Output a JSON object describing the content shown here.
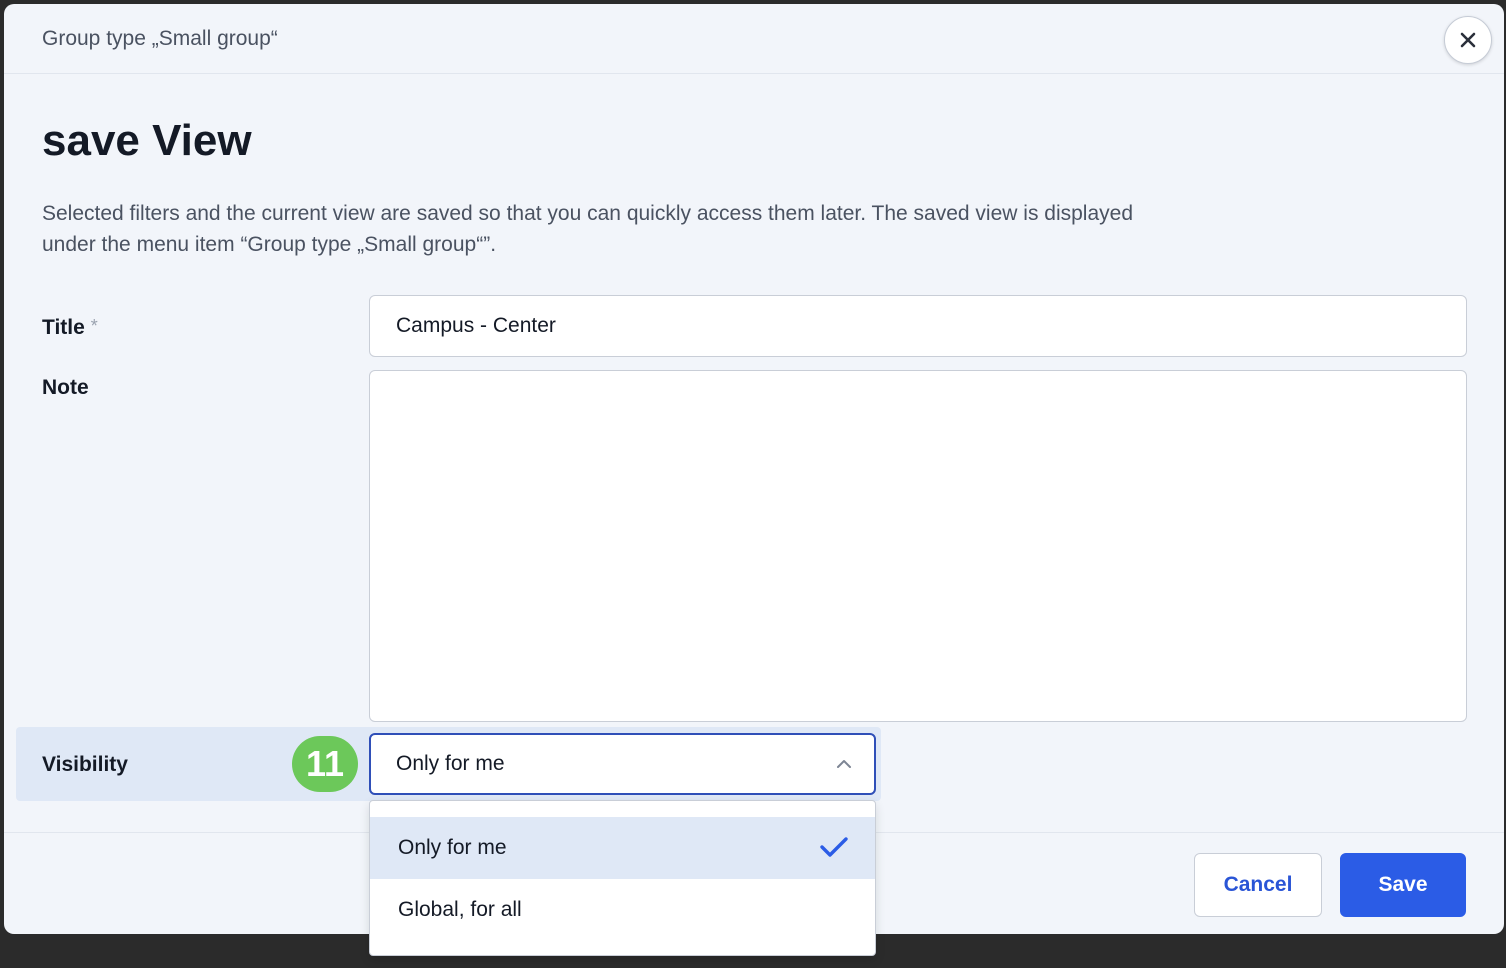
{
  "modal": {
    "header_title": "Group type „Small group“",
    "close_icon": "close-icon",
    "page_title": "save View",
    "description": "Selected filters and the current view are saved so that you can quickly access them later. The saved view is displayed under the menu item “Group type „Small group“”."
  },
  "form": {
    "title_label": "Title",
    "title_required": "*",
    "title_value": "Campus - Center",
    "note_label": "Note",
    "note_value": "",
    "visibility_label": "Visibility",
    "step_badge": "11",
    "visibility_selected": "Only for me",
    "visibility_options": [
      {
        "label": "Only for me",
        "selected": true
      },
      {
        "label": "Global, for all",
        "selected": false
      }
    ]
  },
  "footer": {
    "cancel_label": "Cancel",
    "save_label": "Save"
  },
  "colors": {
    "accent": "#2b5ce6",
    "badge": "#6cc85a",
    "highlight": "#dfe8f6"
  }
}
